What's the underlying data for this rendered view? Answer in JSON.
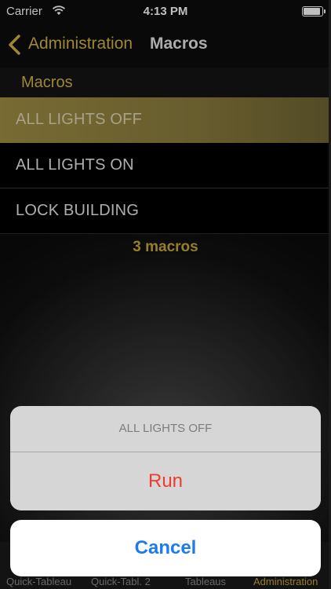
{
  "status_bar": {
    "carrier": "Carrier",
    "time": "4:13 PM",
    "battery_level": 0.9
  },
  "nav": {
    "back_label": "Administration",
    "title": "Macros"
  },
  "section": {
    "header": "Macros"
  },
  "macros": [
    {
      "label": "ALL LIGHTS OFF",
      "selected": true
    },
    {
      "label": "ALL LIGHTS ON",
      "selected": false
    },
    {
      "label": "LOCK BUILDING",
      "selected": false
    }
  ],
  "count_label": "3 macros",
  "tabs": [
    {
      "label": "Quick-Tableau",
      "active": false
    },
    {
      "label": "Quick-Tabl. 2",
      "active": false
    },
    {
      "label": "Tableaus",
      "active": false
    },
    {
      "label": "Administration",
      "active": true
    }
  ],
  "action_sheet": {
    "title": "ALL LIGHTS OFF",
    "run_label": "Run",
    "cancel_label": "Cancel"
  },
  "colors": {
    "accent_gold": "#d4b445",
    "destructive_red": "#f03a2f",
    "cancel_blue": "#1d7bf2"
  }
}
